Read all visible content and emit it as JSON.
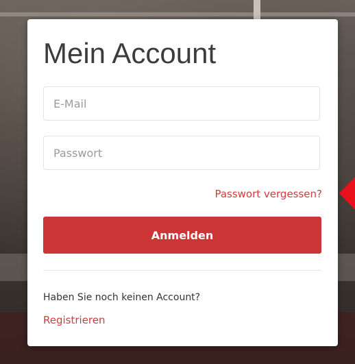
{
  "login": {
    "title": "Mein Account",
    "email_placeholder": "E-Mail",
    "password_placeholder": "Passwort",
    "forgot_link": "Passwort vergessen?",
    "submit_label": "Anmelden",
    "no_account_text": "Haben Sie noch keinen Account?",
    "register_link": "Registrieren"
  },
  "colors": {
    "accent": "#cc3535",
    "arrow": "#e8101a"
  },
  "annotation": {
    "arrow_icon": "left-pointing-arrow"
  }
}
